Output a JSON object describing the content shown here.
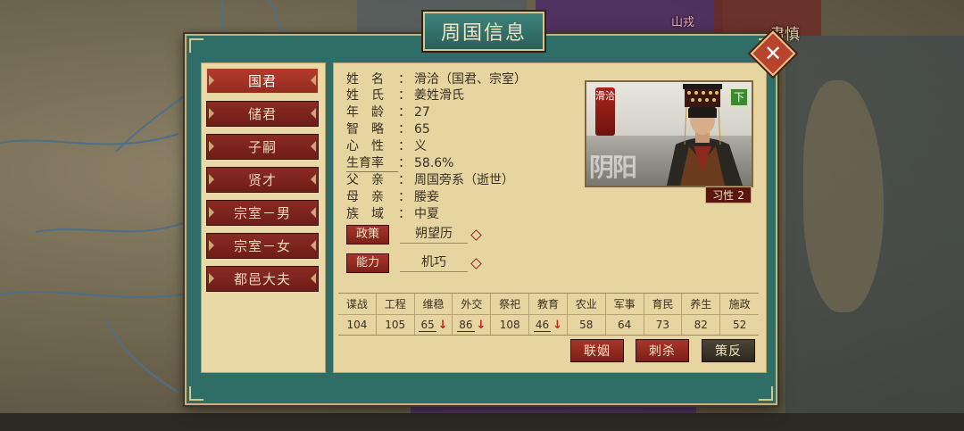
{
  "map": {
    "labels": {
      "shanrong": "山戎",
      "jinshen": "肃慎"
    }
  },
  "dialog": {
    "title": "周国信息",
    "close_symbol": "✕",
    "tabs": [
      {
        "label": "国君",
        "active": true
      },
      {
        "label": "储君",
        "active": false
      },
      {
        "label": "子嗣",
        "active": false
      },
      {
        "label": "贤才",
        "active": false
      },
      {
        "label": "宗室－男",
        "active": false
      },
      {
        "label": "宗室－女",
        "active": false
      },
      {
        "label": "都邑大夫",
        "active": false
      }
    ],
    "fields": [
      {
        "label": "姓　名",
        "value": "滑洽（国君、宗室）"
      },
      {
        "label": "姓　氏",
        "value": "姜姓滑氏"
      },
      {
        "label": "年　龄",
        "value": "27"
      },
      {
        "label": "智　略",
        "value": "65"
      },
      {
        "label": "心　性",
        "value": "义"
      },
      {
        "label": "生育率",
        "value": "58.6%"
      },
      {
        "label": "父　亲",
        "value": "周国旁系（逝世）"
      },
      {
        "label": "母　亲",
        "value": "媵妾"
      },
      {
        "label": "族　域",
        "value": "中夏"
      }
    ],
    "portrait": {
      "name_seal": "滑洽",
      "watermark": "阴阳",
      "badge": "下",
      "trait_label": "习性",
      "trait_value": "2"
    },
    "policy": {
      "label": "政策",
      "value": "朔望历"
    },
    "ability": {
      "label": "能力",
      "value": "机巧"
    },
    "stats": [
      {
        "name": "谍战",
        "value": "104",
        "down": false
      },
      {
        "name": "工程",
        "value": "105",
        "down": false
      },
      {
        "name": "维稳",
        "value": "65",
        "down": true
      },
      {
        "name": "外交",
        "value": "86",
        "down": true
      },
      {
        "name": "祭祀",
        "value": "108",
        "down": false
      },
      {
        "name": "教育",
        "value": "46",
        "down": true
      },
      {
        "name": "农业",
        "value": "58",
        "down": false
      },
      {
        "name": "军事",
        "value": "64",
        "down": false
      },
      {
        "name": "育民",
        "value": "73",
        "down": false
      },
      {
        "name": "养生",
        "value": "82",
        "down": false
      },
      {
        "name": "施政",
        "value": "52",
        "down": false
      }
    ],
    "actions": {
      "marriage": "联姻",
      "assassinate": "刺杀",
      "subvert": "策反"
    }
  },
  "colors": {
    "frame": "#2f6d67",
    "tab_red": "#8a2b22",
    "panel": "#e6d5a1",
    "gold": "#c8b27c"
  }
}
